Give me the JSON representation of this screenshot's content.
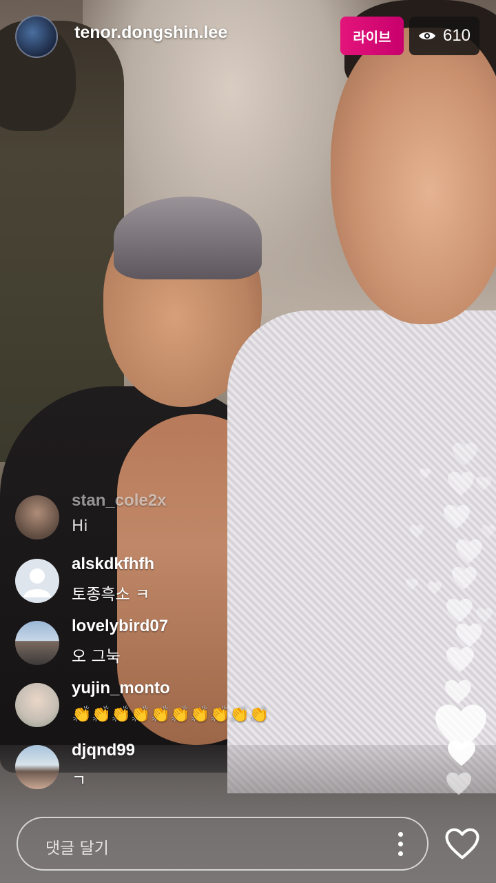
{
  "header": {
    "host_username": "tenor.dongshin.lee",
    "live_label": "라이브",
    "viewer_icon": "eye-icon",
    "viewer_count": "610"
  },
  "comments": [
    {
      "username": "stan_cole2x",
      "text": "Hi",
      "faded": true
    },
    {
      "username": "alskdkfhfh",
      "text": "토종흑소 ㅋ",
      "faded": false
    },
    {
      "username": "lovelybird07",
      "text": "오 그눅",
      "faded": false
    },
    {
      "username": "yujin_monto",
      "text": "👏👏👏👏👏👏👏👏👏👏",
      "faded": false
    },
    {
      "username": "djqnd99",
      "text": "ㄱ",
      "faded": false
    }
  ],
  "footer": {
    "comment_placeholder": "댓글 달기",
    "more_icon": "more-vertical-icon",
    "like_icon": "heart-outline-icon"
  },
  "colors": {
    "live_badge": "#d4006f",
    "viewer_badge": "#141414",
    "text": "#ffffff"
  }
}
